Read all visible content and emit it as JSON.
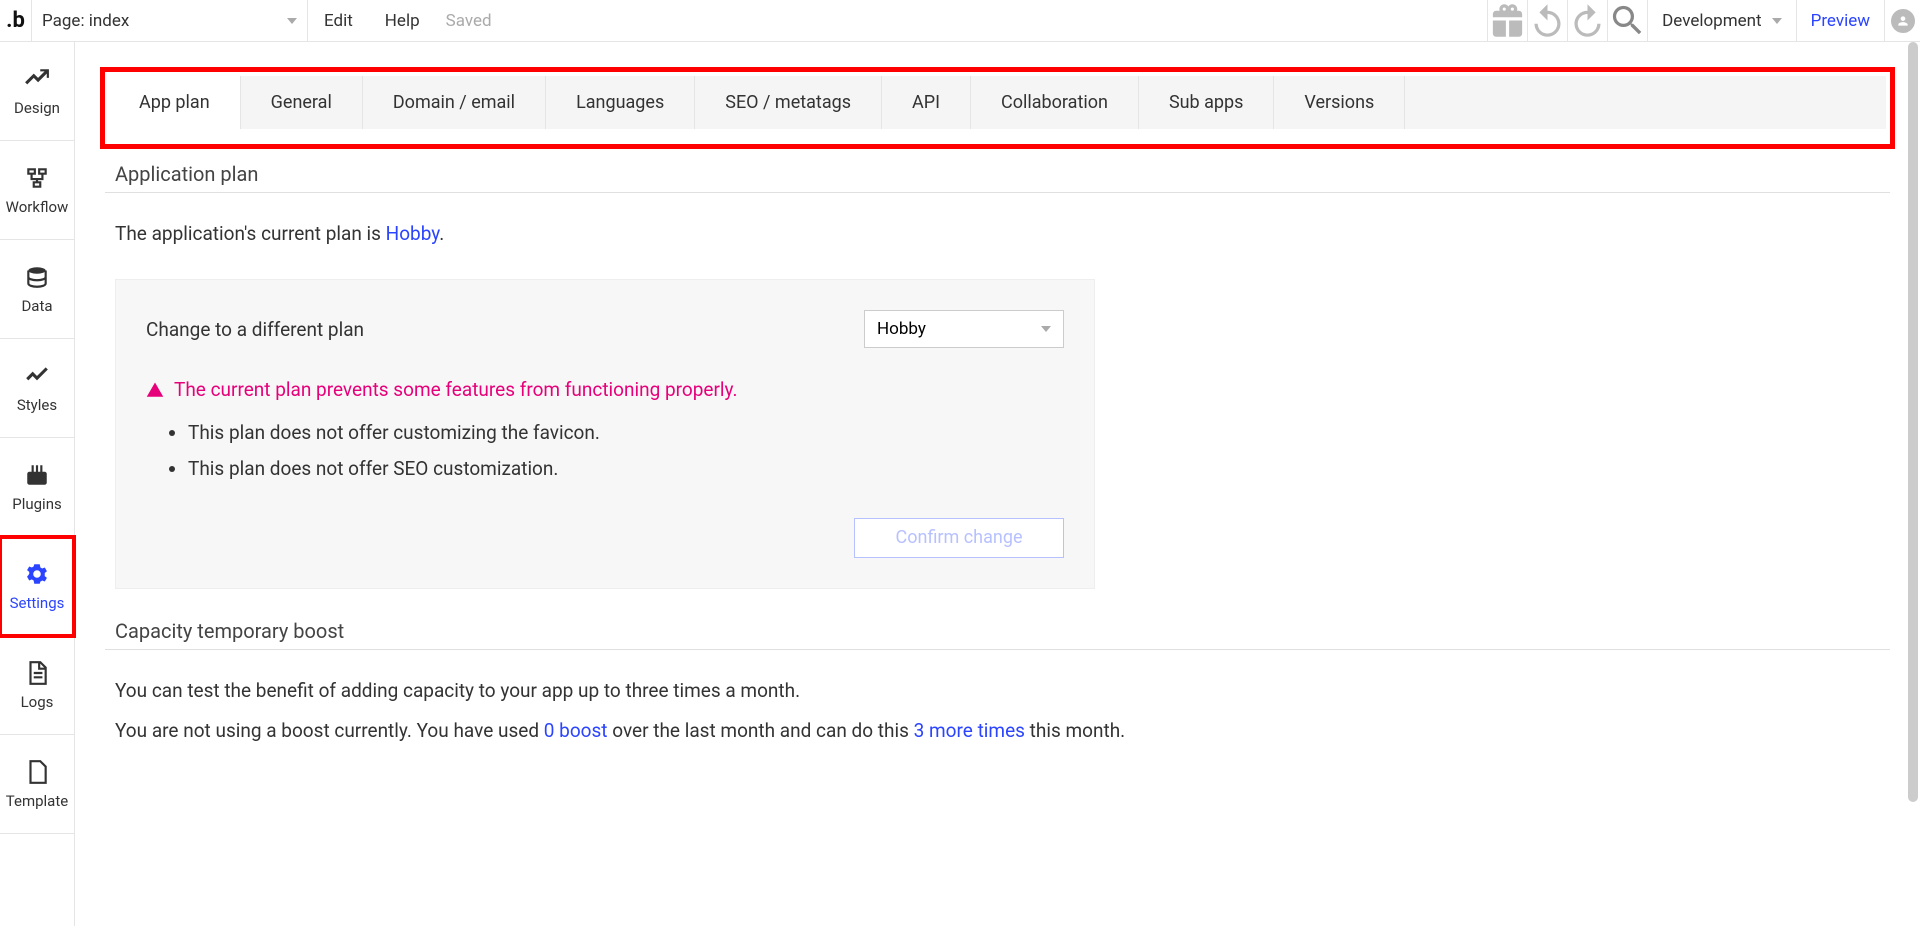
{
  "topbar": {
    "page_label": "Page: index",
    "menu": {
      "edit": "Edit",
      "help": "Help",
      "saved": "Saved"
    },
    "dev_label": "Development",
    "preview": "Preview"
  },
  "sidebar": {
    "items": [
      {
        "label": "Design"
      },
      {
        "label": "Workflow"
      },
      {
        "label": "Data"
      },
      {
        "label": "Styles"
      },
      {
        "label": "Plugins"
      },
      {
        "label": "Settings"
      },
      {
        "label": "Logs"
      },
      {
        "label": "Template"
      }
    ]
  },
  "tabs": [
    "App plan",
    "General",
    "Domain / email",
    "Languages",
    "SEO / metatags",
    "API",
    "Collaboration",
    "Sub apps",
    "Versions"
  ],
  "app_plan": {
    "section_title": "Application plan",
    "current_plan_prefix": "The application's current plan is ",
    "current_plan_name": "Hobby",
    "current_plan_suffix": ".",
    "change_label": "Change to a different plan",
    "selected_plan": "Hobby",
    "warning": "The current plan prevents some features from functioning properly.",
    "limitations": [
      "This plan does not offer customizing the favicon.",
      "This plan does not offer SEO customization."
    ],
    "confirm_label": "Confirm change"
  },
  "boost": {
    "section_title": "Capacity temporary boost",
    "line1": "You can test the benefit of adding capacity to your app up to three times a month.",
    "line2_a": "You are not using a boost currently. You have used ",
    "line2_b": "0 boost",
    "line2_c": " over the last month and can do this ",
    "line2_d": "3 more times",
    "line2_e": " this month."
  }
}
